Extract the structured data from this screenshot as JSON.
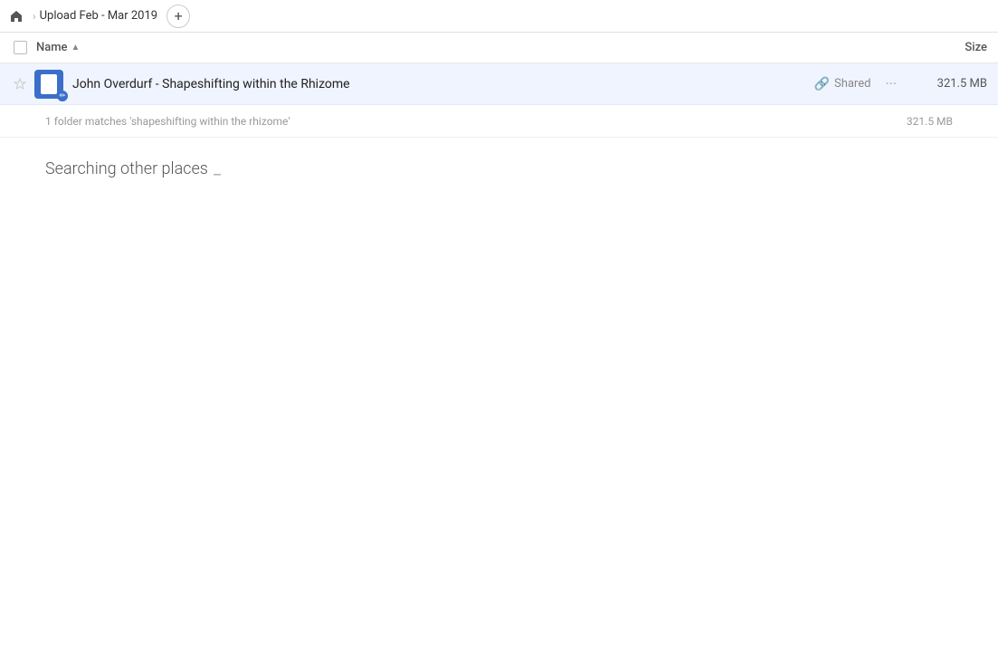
{
  "topbar": {
    "home_icon": "🏠",
    "breadcrumb_title": "Upload Feb - Mar 2019",
    "add_button_label": "+"
  },
  "column_headers": {
    "name_label": "Name",
    "sort_indicator": "▲",
    "size_label": "Size"
  },
  "file_row": {
    "name": "John Overdurf - Shapeshifting within the Rhizome",
    "shared_label": "Shared",
    "size": "321.5 MB"
  },
  "match_row": {
    "text": "1 folder matches 'shapeshifting within the rhizome'",
    "size": "321.5 MB"
  },
  "searching_section": {
    "text": "Searching other places",
    "loading": "…"
  }
}
